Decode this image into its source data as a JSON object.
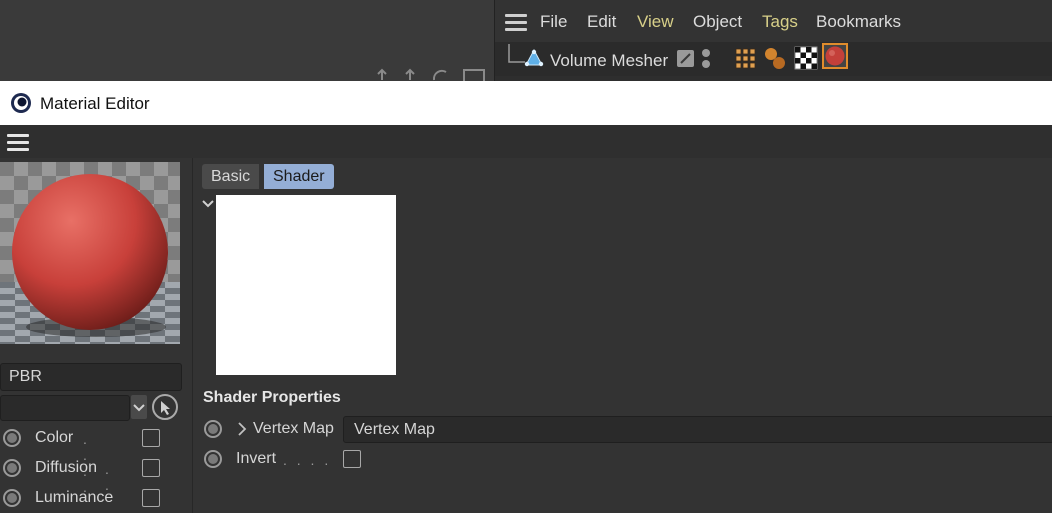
{
  "object_manager": {
    "menu": [
      "File",
      "Edit",
      "View",
      "Object",
      "Tags",
      "Bookmarks"
    ],
    "highlight_color": "#d8d089",
    "object_name": "Volume Mesher"
  },
  "material_editor": {
    "title": "Material Editor",
    "material_name": "PBR",
    "channels": [
      {
        "label": "Color",
        "checked": false
      },
      {
        "label": "Diffusion",
        "checked": false
      },
      {
        "label": "Luminance",
        "checked": false
      }
    ],
    "tabs": [
      {
        "label": "Basic",
        "active": false
      },
      {
        "label": "Shader",
        "active": true
      }
    ],
    "section_title": "Shader Properties",
    "vertex_map": {
      "label": "Vertex Map",
      "value": "Vertex Map"
    },
    "invert": {
      "label": "Invert",
      "checked": false
    },
    "accent_color": "#94aed6",
    "preview_sphere_color": "#c8403a"
  }
}
